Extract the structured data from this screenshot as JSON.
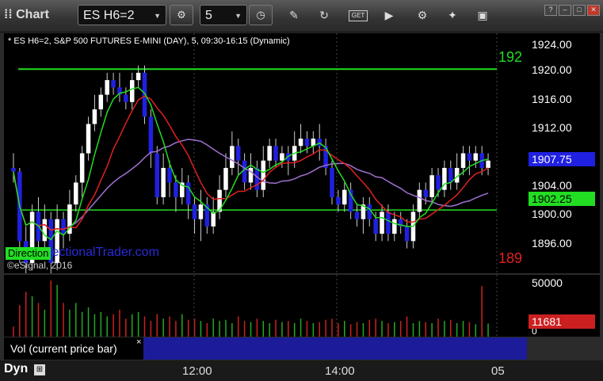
{
  "app": {
    "title": "Chart"
  },
  "toolbar": {
    "symbol": "ES H6=2",
    "interval": "5",
    "icons": [
      "crosshair-gear-icon",
      "clock-icon",
      "pencil-icon",
      "refresh-icon",
      "get-icon",
      "play-icon",
      "settings-icon",
      "pin-icon",
      "layout-icon"
    ],
    "get_label": "GET"
  },
  "chart": {
    "header": "* ES H6=2, S&P 500 FUTURES E-MINI (DAY), 5, 09:30-16:15 (Dynamic)",
    "copyright": "©eSignal, 2016",
    "watermark": "DirectionalTrader.com",
    "badge": "Direction",
    "price_ticks": [
      "1924.00",
      "1920.00",
      "1916.00",
      "1912.00",
      "1904.00",
      "1900.00",
      "1896.00"
    ],
    "last_price_tag": "1907.75",
    "level_tag": "1902.25",
    "upper_line_label": "192",
    "lower_line_label": "189",
    "volume_ticks": [
      "50000",
      "0"
    ],
    "volume_tag": "11681",
    "volume_label": "Vol (current price bar)",
    "close_symbol": "×",
    "time_labels": [
      "12:00",
      "14:00",
      "05"
    ],
    "dyn_label": "Dyn",
    "colors": {
      "up": "#ffffff",
      "down": "#2020e0",
      "ma_fast": "#22dd22",
      "ma_mid": "#e02020",
      "ma_slow": "#a070d0",
      "green_line": "#22dd22",
      "red_line": "#e02020",
      "vol_up": "#22aa22",
      "vol_down": "#cc2020"
    }
  },
  "chart_data": {
    "type": "candlestick",
    "title": "ES H6=2, S&P 500 FUTURES E-MINI (DAY), 5, 09:30-16:15 (Dynamic)",
    "ylim": [
      1893.6,
      1926.4
    ],
    "upper_line": 1921.5,
    "lower_line": 1889.5,
    "level_line": 1902.25,
    "last_price": 1907.75,
    "candles": [
      [
        1908,
        1907.5,
        1910,
        1906
      ],
      [
        1907.5,
        1898,
        1908,
        1895
      ],
      [
        1898,
        1895,
        1900,
        1893
      ],
      [
        1895,
        1902,
        1903,
        1894
      ],
      [
        1902,
        1898,
        1904,
        1896
      ],
      [
        1898,
        1901,
        1903,
        1897
      ],
      [
        1901,
        1895,
        1902,
        1893
      ],
      [
        1895,
        1901,
        1903,
        1894
      ],
      [
        1901,
        1899,
        1902,
        1897
      ],
      [
        1899,
        1903,
        1905,
        1898
      ],
      [
        1903,
        1906,
        1907,
        1902
      ],
      [
        1906,
        1910,
        1911,
        1904
      ],
      [
        1910,
        1914,
        1915,
        1909
      ],
      [
        1914,
        1916,
        1918,
        1913
      ],
      [
        1916,
        1918,
        1919,
        1915
      ],
      [
        1918,
        1920,
        1921,
        1917
      ],
      [
        1920,
        1919,
        1921,
        1918
      ],
      [
        1919,
        1918,
        1921,
        1917
      ],
      [
        1918,
        1917,
        1919,
        1916
      ],
      [
        1917,
        1920,
        1921,
        1916
      ],
      [
        1920,
        1921,
        1922,
        1919
      ],
      [
        1921,
        1915,
        1922,
        1914
      ],
      [
        1915,
        1910,
        1916,
        1908
      ],
      [
        1910,
        1904,
        1911,
        1903
      ],
      [
        1904,
        1908,
        1910,
        1903
      ],
      [
        1908,
        1906,
        1909,
        1904
      ],
      [
        1906,
        1904,
        1907,
        1902
      ],
      [
        1904,
        1906,
        1908,
        1903
      ],
      [
        1906,
        1903,
        1907,
        1901
      ],
      [
        1903,
        1901,
        1904,
        1899
      ],
      [
        1901,
        1903,
        1905,
        1898
      ],
      [
        1903,
        1900,
        1904,
        1899
      ],
      [
        1900,
        1902,
        1904,
        1899
      ],
      [
        1902,
        1905,
        1907,
        1901
      ],
      [
        1905,
        1908,
        1910,
        1904
      ],
      [
        1908,
        1911,
        1913,
        1907
      ],
      [
        1911,
        1909,
        1912,
        1907
      ],
      [
        1909,
        1906,
        1910,
        1905
      ],
      [
        1906,
        1908,
        1910,
        1905
      ],
      [
        1908,
        1905,
        1909,
        1904
      ],
      [
        1905,
        1909,
        1911,
        1904
      ],
      [
        1909,
        1911,
        1912,
        1908
      ],
      [
        1911,
        1909,
        1912,
        1908
      ],
      [
        1909,
        1910,
        1911,
        1908
      ],
      [
        1910,
        1909,
        1911,
        1907
      ],
      [
        1909,
        1911,
        1913,
        1908
      ],
      [
        1911,
        1912,
        1914,
        1910
      ],
      [
        1912,
        1911,
        1913,
        1910
      ],
      [
        1911,
        1912,
        1913,
        1910
      ],
      [
        1912,
        1911,
        1914,
        1909
      ],
      [
        1911,
        1908,
        1912,
        1907
      ],
      [
        1908,
        1904,
        1909,
        1903
      ],
      [
        1904,
        1903,
        1905,
        1902
      ],
      [
        1903,
        1905,
        1906,
        1902
      ],
      [
        1905,
        1902,
        1906,
        1901
      ],
      [
        1902,
        1901,
        1903,
        1900
      ],
      [
        1901,
        1903,
        1904,
        1899
      ],
      [
        1903,
        1901,
        1904,
        1900
      ],
      [
        1901,
        1899,
        1902,
        1898
      ],
      [
        1899,
        1902,
        1903,
        1898
      ],
      [
        1902,
        1899,
        1903,
        1898
      ],
      [
        1899,
        1901,
        1902,
        1898
      ],
      [
        1901,
        1900,
        1902,
        1899
      ],
      [
        1900,
        1898,
        1901,
        1897
      ],
      [
        1898,
        1902,
        1903,
        1897
      ],
      [
        1902,
        1905,
        1906,
        1901
      ],
      [
        1905,
        1904,
        1906,
        1903
      ],
      [
        1904,
        1907,
        1908,
        1903
      ],
      [
        1907,
        1905,
        1908,
        1904
      ],
      [
        1905,
        1908,
        1909,
        1904
      ],
      [
        1908,
        1906,
        1909,
        1905
      ],
      [
        1906,
        1908,
        1910,
        1905
      ],
      [
        1908,
        1910,
        1911,
        1907
      ],
      [
        1910,
        1909,
        1911,
        1907
      ],
      [
        1909,
        1910,
        1911,
        1908
      ],
      [
        1910,
        1908,
        1911,
        1907
      ],
      [
        1908,
        1909,
        1910,
        1907
      ]
    ],
    "volume_ylim": [
      0,
      55000
    ],
    "volume": [
      9000,
      28000,
      40000,
      36000,
      30000,
      24000,
      50000,
      46000,
      30000,
      24000,
      30000,
      22000,
      26000,
      20000,
      22000,
      18000,
      20000,
      24000,
      16000,
      20000,
      22000,
      18000,
      14000,
      20000,
      16000,
      18000,
      14000,
      20000,
      15000,
      16000,
      14000,
      12000,
      16000,
      14000,
      15000,
      12000,
      18000,
      14000,
      13000,
      16000,
      14000,
      12000,
      15000,
      13000,
      14000,
      12000,
      16000,
      14000,
      12000,
      13000,
      15000,
      16000,
      12000,
      14000,
      11000,
      13000,
      12000,
      15000,
      16000,
      14000,
      12000,
      13000,
      14000,
      18000,
      12000,
      14000,
      13000,
      12000,
      16000,
      14000,
      15000,
      12000,
      14000,
      13000,
      11000,
      45000,
      11681
    ]
  }
}
